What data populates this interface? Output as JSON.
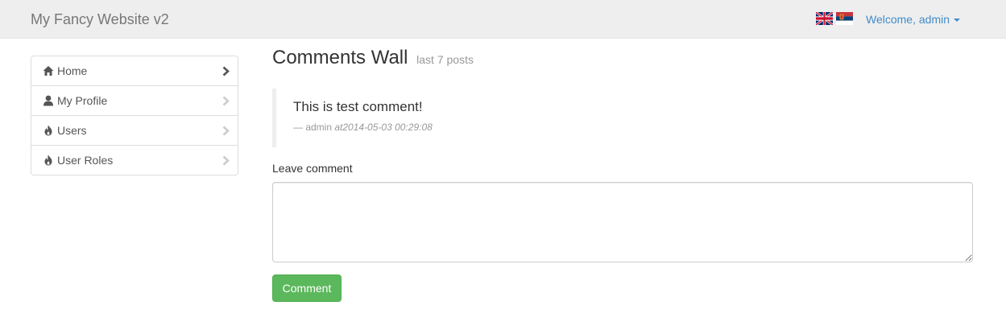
{
  "navbar": {
    "brand": "My Fancy Website v2",
    "languages": [
      {
        "name": "English",
        "icon": "uk-flag-icon"
      },
      {
        "name": "Serbian",
        "icon": "serbia-flag-icon"
      }
    ],
    "user_menu_label": "Welcome, admin"
  },
  "sidebar": {
    "items": [
      {
        "label": "Home",
        "icon": "home-icon",
        "active": true
      },
      {
        "label": "My Profile",
        "icon": "user-icon",
        "active": false
      },
      {
        "label": "Users",
        "icon": "fire-icon",
        "active": false
      },
      {
        "label": "User Roles",
        "icon": "fire-icon",
        "active": false
      }
    ]
  },
  "main": {
    "title": "Comments Wall",
    "subtitle": "last 7 posts",
    "comments": [
      {
        "text": "This is test comment!",
        "author_prefix": "— admin ",
        "timestamp": "at2014-05-03 00:29:08"
      }
    ],
    "form": {
      "label": "Leave comment",
      "value": "",
      "submit_label": "Comment"
    }
  },
  "colors": {
    "link": "#428bca",
    "success": "#5cb85c",
    "navbar_bg": "#eeeeee"
  }
}
